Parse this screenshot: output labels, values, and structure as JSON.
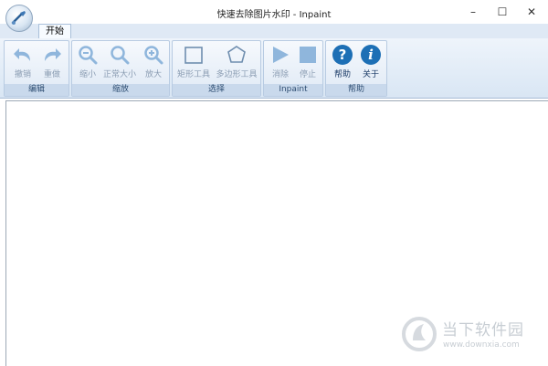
{
  "window": {
    "title": "快速去除图片水印 - Inpaint"
  },
  "controls": {
    "minimize": "–",
    "maximize": "☐",
    "close": "✕"
  },
  "tabs": [
    {
      "label": "开始"
    }
  ],
  "ribbon": {
    "groups": {
      "edit": {
        "label": "编辑",
        "undo": "撤销",
        "redo": "重做"
      },
      "zoom": {
        "label": "缩放",
        "shrink": "缩小",
        "normal": "正常大小",
        "enlarge": "放大"
      },
      "select": {
        "label": "选择",
        "rect": "矩形工具",
        "polygon": "多边形工具"
      },
      "inpaint": {
        "label": "Inpaint",
        "erase": "消除",
        "stop": "停止"
      },
      "help": {
        "label": "帮助",
        "help": "帮助",
        "about": "关于"
      }
    }
  },
  "watermark": {
    "name": "当下软件园",
    "url": "www.downxia.com"
  },
  "colors": {
    "accent": "#1d6fb5",
    "disabled_icon": "#8fb6dc"
  }
}
